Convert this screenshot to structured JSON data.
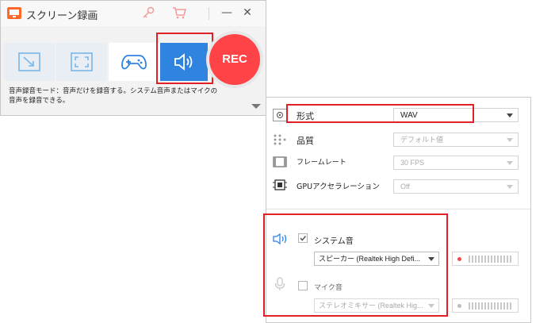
{
  "recorder": {
    "title": "スクリーン録画",
    "window_controls": {
      "minimize": "—",
      "close": "✕"
    },
    "rec_label": "REC",
    "mode_description": "音声録音モード：音声だけを録音する。システム音声またはマイクの音声を録音できる。"
  },
  "settings": {
    "format": {
      "label": "形式",
      "value": "WAV"
    },
    "quality": {
      "label": "品質",
      "value": "デフォルト値"
    },
    "framerate": {
      "label": "フレームレート",
      "value": "30 FPS"
    },
    "gpu": {
      "label": "GPUアクセラレーション",
      "value": "Off"
    },
    "system_audio": {
      "label": "システム音",
      "checked": true,
      "device": "スピーカー (Realtek High Defi..."
    },
    "mic_audio": {
      "label": "マイク音",
      "checked": false,
      "device": "ステレオミキサー (Realtek Hig..."
    }
  },
  "colors": {
    "accent": "#2f84df",
    "rec": "#ff4347",
    "highlight": "#e02025",
    "meter_active": "#ff4347",
    "meter_inactive": "#bdbdbd"
  }
}
